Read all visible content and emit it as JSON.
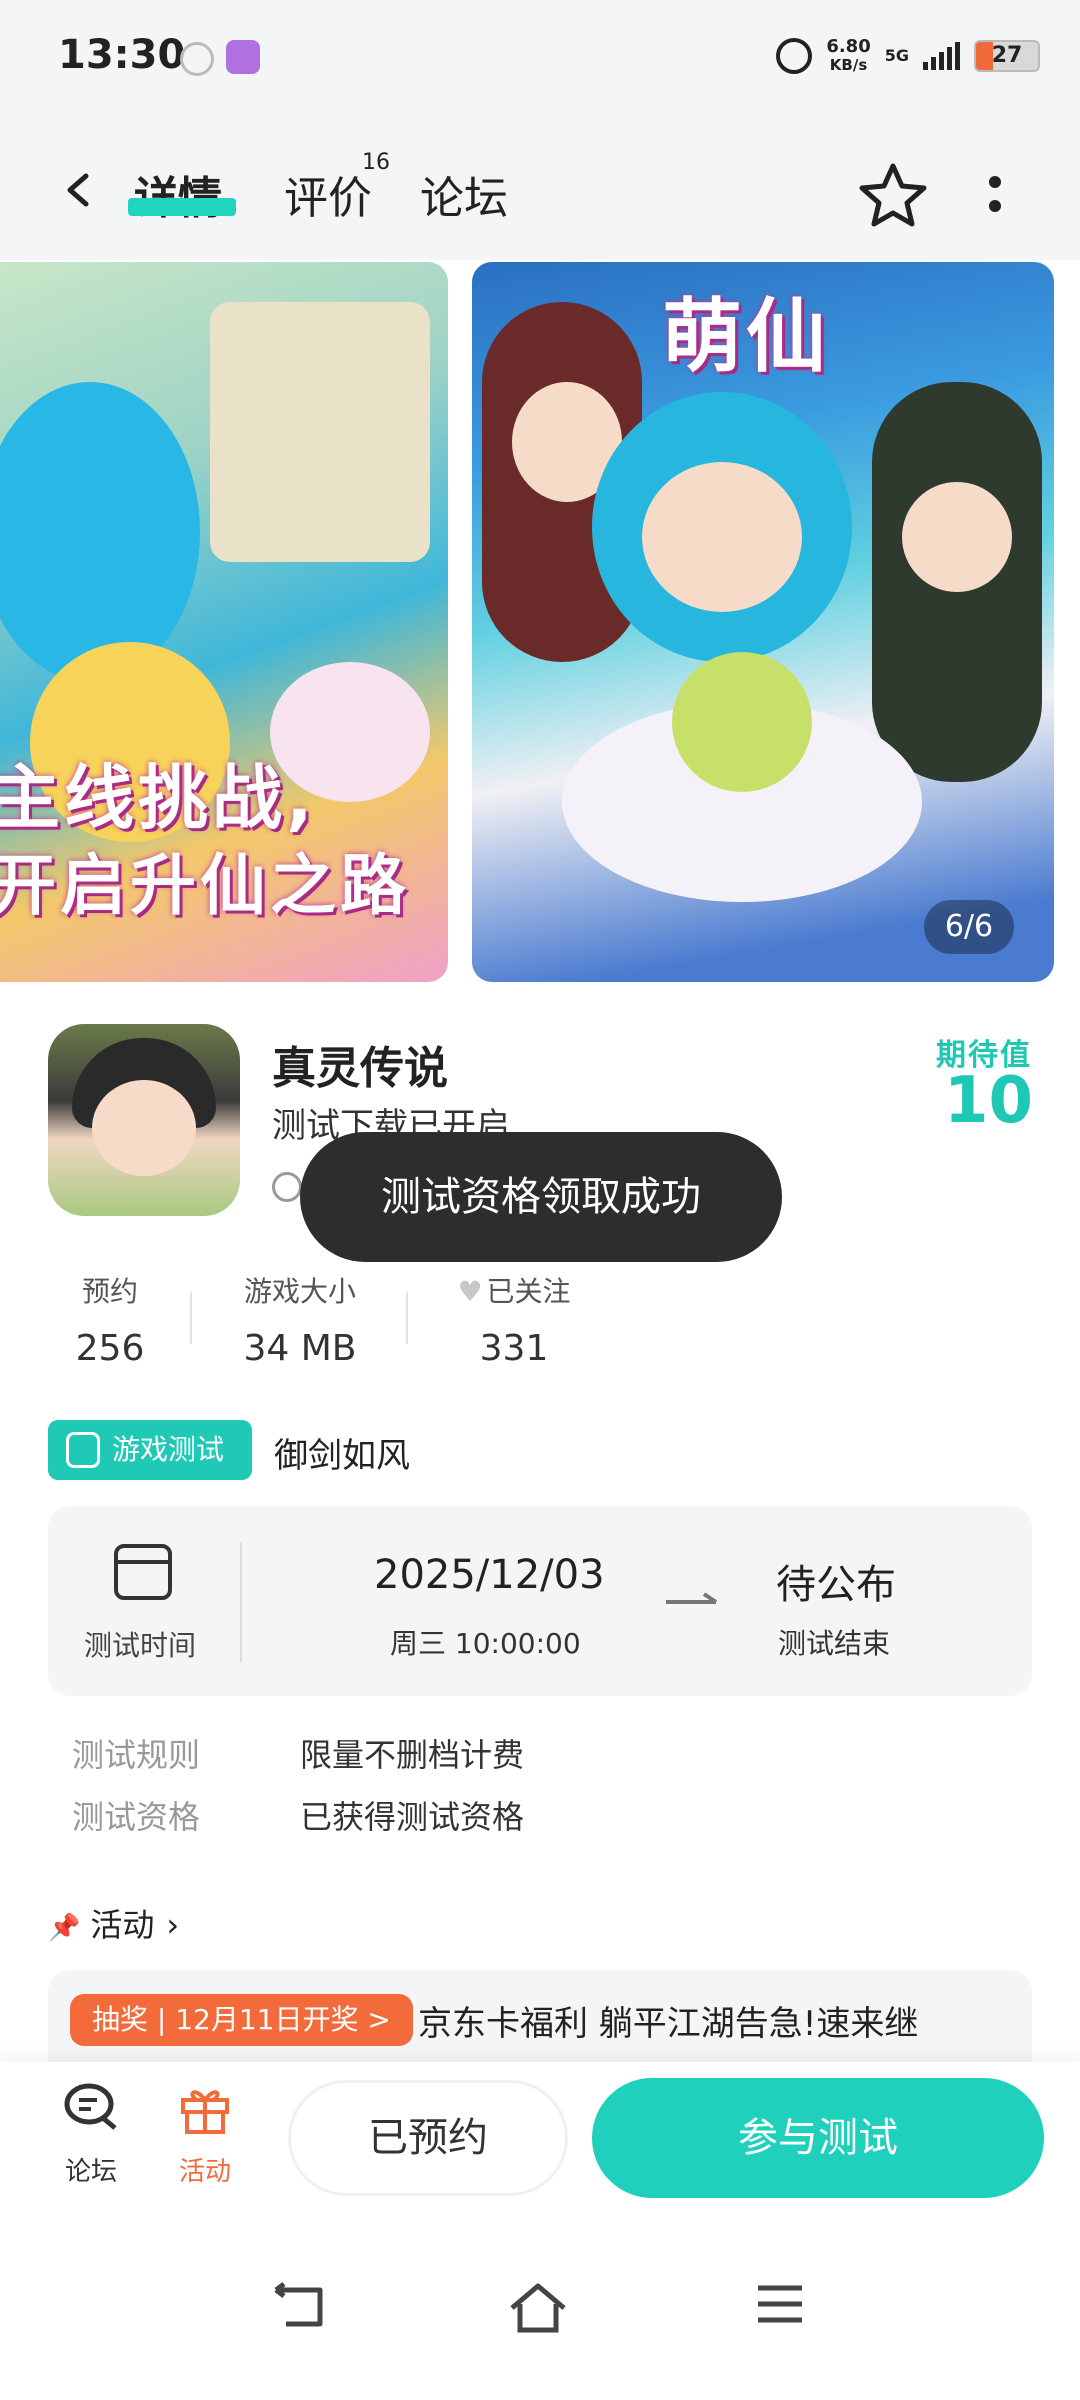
{
  "status_bar": {
    "time": "13:30",
    "speed_value": "6.80",
    "speed_unit": "KB/s",
    "network": "5G",
    "battery": "27",
    "icons": [
      "clock-app-icon",
      "launcher-app-icon",
      "alarm-icon",
      "signal-icon",
      "battery-icon"
    ]
  },
  "nav": {
    "tabs": [
      {
        "label": "详情",
        "active": true
      },
      {
        "label": "评价",
        "badge": "16"
      },
      {
        "label": "论坛"
      }
    ],
    "icons": [
      "back-icon",
      "star-icon",
      "more-icon"
    ]
  },
  "gallery": {
    "shot1_text_line1": "主线挑战,",
    "shot1_text_line2": "开启升仙之路",
    "shot2_text": "萌仙",
    "pager": "6/6"
  },
  "game": {
    "title": "真灵传说",
    "status": "测试下载已开启",
    "expect_label": "期待值",
    "expect_value": "10"
  },
  "toast": "测试资格领取成功",
  "stats": [
    {
      "label": "预约",
      "value": "256"
    },
    {
      "label": "游戏大小",
      "value": "34 MB"
    },
    {
      "label": "已关注",
      "value": "331"
    }
  ],
  "test": {
    "tag": "游戏测试",
    "name": "御剑如风",
    "time_label": "测试时间",
    "start_date": "2025/12/03",
    "start_time": "周三  10:00:00",
    "end_date": "待公布",
    "end_label": "测试结束",
    "rules": [
      {
        "key": "测试规则",
        "value": "限量不删档计费"
      },
      {
        "key": "测试资格",
        "value": "已获得测试资格"
      }
    ]
  },
  "activity": {
    "title": "活动",
    "badge": "抽奖 | 12月11日开奖 >",
    "text": "京东卡福利 躺平江湖告急!速来继"
  },
  "bottom_bar": {
    "forum_label": "论坛",
    "activity_label": "活动",
    "reserved_label": "已预约",
    "join_label": "参与测试"
  },
  "colors": {
    "accent": "#1fd1bd",
    "orange": "#f36b3b",
    "toast_bg": "#2d2d2d"
  }
}
